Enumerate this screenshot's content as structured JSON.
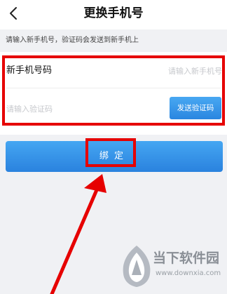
{
  "header": {
    "title": "更换手机号",
    "back_icon": "chevron-left-icon"
  },
  "hint_text": "请输入新手机号，验证码会发送到新手机上",
  "form": {
    "phone_label": "新手机号码",
    "phone_placeholder": "请输入新手机号",
    "code_placeholder": "请输入验证码",
    "send_code_label": "发送验证码"
  },
  "bind_button_label": "绑 定",
  "watermark": {
    "name": "当下软件园",
    "url": "www.downxia.com"
  },
  "colors": {
    "accent_blue": "#3196e8",
    "highlight_red": "#e60000",
    "background_gray": "#f0f1f4"
  }
}
